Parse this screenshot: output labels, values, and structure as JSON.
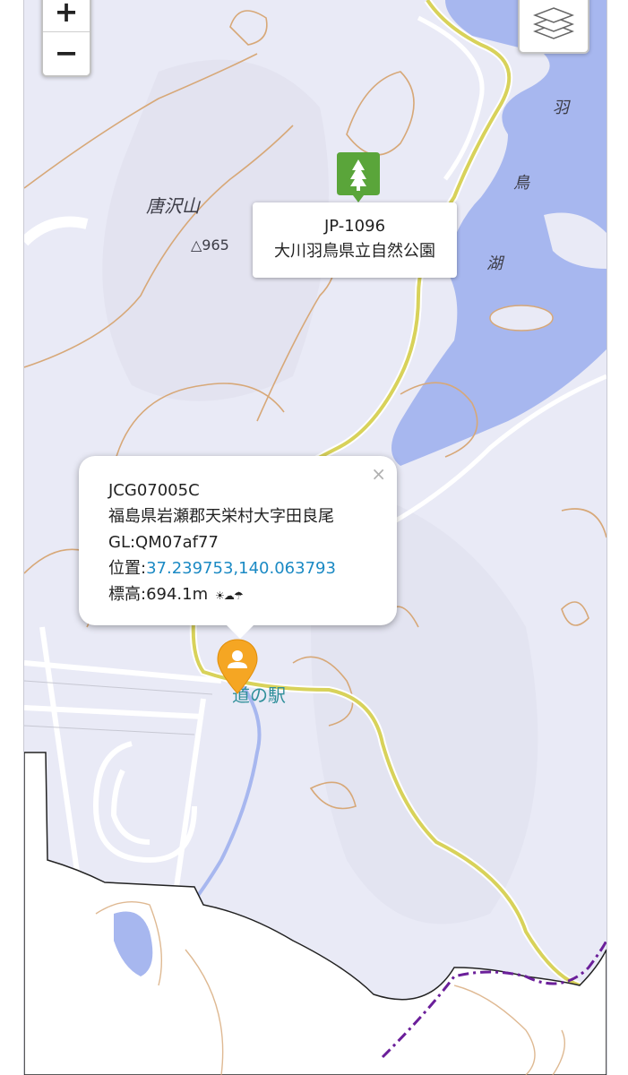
{
  "controls": {
    "zoom_in": "+",
    "zoom_out": "−",
    "layers_icon": "layers-icon"
  },
  "map_labels": {
    "mountain_name": "唐沢山",
    "summit_elevation": "△965",
    "lake_char_1": "羽",
    "lake_char_2": "鳥",
    "lake_char_3": "湖",
    "michi_no_eki": "道の駅"
  },
  "park_marker": {
    "icon": "tree-icon",
    "color": "#5aa53a",
    "ref": "JP-1096",
    "name": "大川羽鳥県立自然公園"
  },
  "user_marker": {
    "icon": "person-icon",
    "color": "#f5a623"
  },
  "popup": {
    "callsign": "JCG07005C",
    "address": "福島県岩瀬郡天栄村大字田良尾",
    "grid": "GL:QM07af77",
    "position_label": "位置:",
    "position_value": "37.239753,140.063793",
    "elevation": "標高:694.1m",
    "weather_icons": "☀☁☂",
    "close": "×"
  },
  "colors": {
    "lake": "#a7b7ef",
    "road": "#d8d25a",
    "contour": "#d7a878",
    "land": "#e9eaf6",
    "outside_area": "#ffffff",
    "trail": "#6b1f9a"
  }
}
